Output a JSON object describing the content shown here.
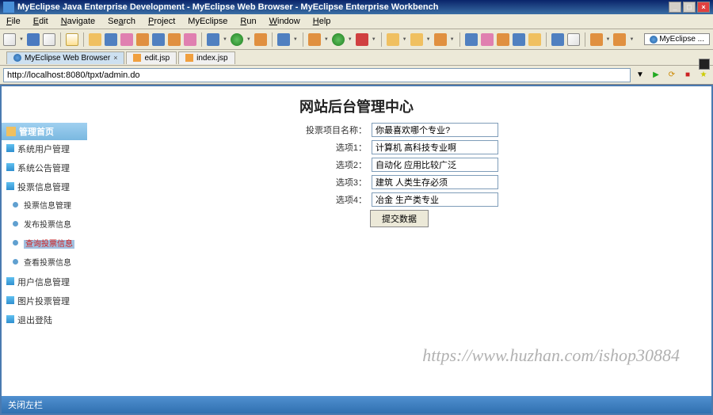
{
  "title": "MyEclipse Java Enterprise Development - MyEclipse Web Browser - MyEclipse Enterprise Workbench",
  "menu": {
    "file": "File",
    "edit": "Edit",
    "navigate": "Navigate",
    "search": "Search",
    "project": "Project",
    "myeclipse": "MyEclipse",
    "run": "Run",
    "window": "Window",
    "help": "Help"
  },
  "perspective": "MyEclipse ...",
  "tabs": {
    "browser": "MyEclipse Web Browser",
    "edit": "edit.jsp",
    "index": "index.jsp"
  },
  "url": "http://localhost:8080/tpxt/admin.do",
  "page": {
    "title": "网站后台管理中心",
    "watermark": "https://www.huzhan.com/ishop30884",
    "footer": "关闭左栏"
  },
  "sidebar": {
    "header": "管理首页",
    "items": [
      "系统用户管理",
      "系统公告管理",
      "投票信息管理"
    ],
    "subitems": [
      "投票信息管理",
      "发布投票信息",
      "查询投票信息",
      "查看投票信息"
    ],
    "items2": [
      "用户信息管理",
      "图片投票管理",
      "退出登陆"
    ]
  },
  "form": {
    "label_name": "投票项目名称：",
    "value_name": "你最喜欢哪个专业?",
    "label_opt1": "选项1：",
    "value_opt1": "计算机 高科技专业啊",
    "label_opt2": "选项2：",
    "value_opt2": "自动化 应用比较广泛",
    "label_opt3": "选项3：",
    "value_opt3": "建筑 人类生存必须",
    "label_opt4": "选项4：",
    "value_opt4": "冶金 生产类专业",
    "submit": "提交数据"
  }
}
